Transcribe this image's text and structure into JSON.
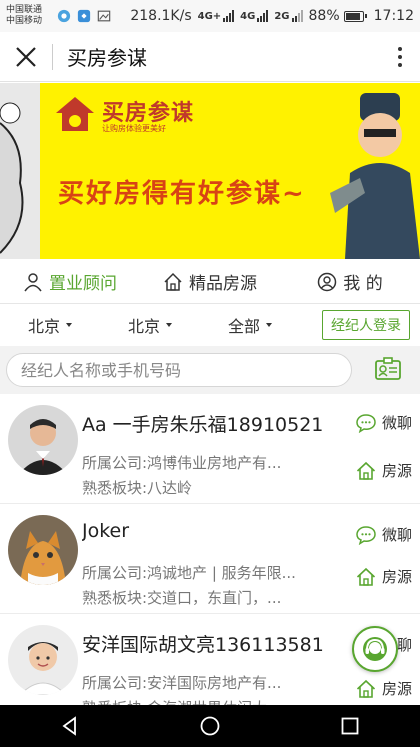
{
  "status_bar": {
    "carrier_1": "中国联通",
    "carrier_2": "中国移动",
    "net_speed": "218.1K/s",
    "net_type_1": "4G+",
    "net_type_2": "4G",
    "net_type_3": "2G",
    "battery": "88%",
    "time": "17:12"
  },
  "title_bar": {
    "title": "买房参谋"
  },
  "banner": {
    "logo_text": "买房参谋",
    "logo_sub": "让购房体验更美好",
    "slogan": "买好房得有好参谋~"
  },
  "tabs": [
    {
      "label": "置业顾问",
      "icon": "person-icon",
      "active": true
    },
    {
      "label": "精品房源",
      "icon": "house-icon",
      "active": false
    },
    {
      "label": "我 的",
      "icon": "user-circle-icon",
      "active": false
    }
  ],
  "filters": [
    {
      "label": "北京"
    },
    {
      "label": "北京"
    },
    {
      "label": "全部"
    }
  ],
  "login_button": "经纪人登录",
  "search": {
    "placeholder": "经纪人名称或手机号码"
  },
  "actions": {
    "chat": "微聊",
    "listings": "房源"
  },
  "agents": [
    {
      "name": "Aa 一手房朱乐福18910521",
      "company": "所属公司:鸿博伟业房地产有...",
      "area": "熟悉板块:八达岭"
    },
    {
      "name": "Joker",
      "company": "所属公司:鸿诚地产 | 服务年限...",
      "area": "熟悉板块:交道口，东直门，..."
    },
    {
      "name": "安洋国际胡文亮136113581",
      "company": "所属公司:安洋国际房地产有...",
      "area": "熟悉板块:金海湖世界休闲大..."
    }
  ],
  "colors": {
    "accent": "#59a630",
    "banner_bg": "#fff200"
  }
}
